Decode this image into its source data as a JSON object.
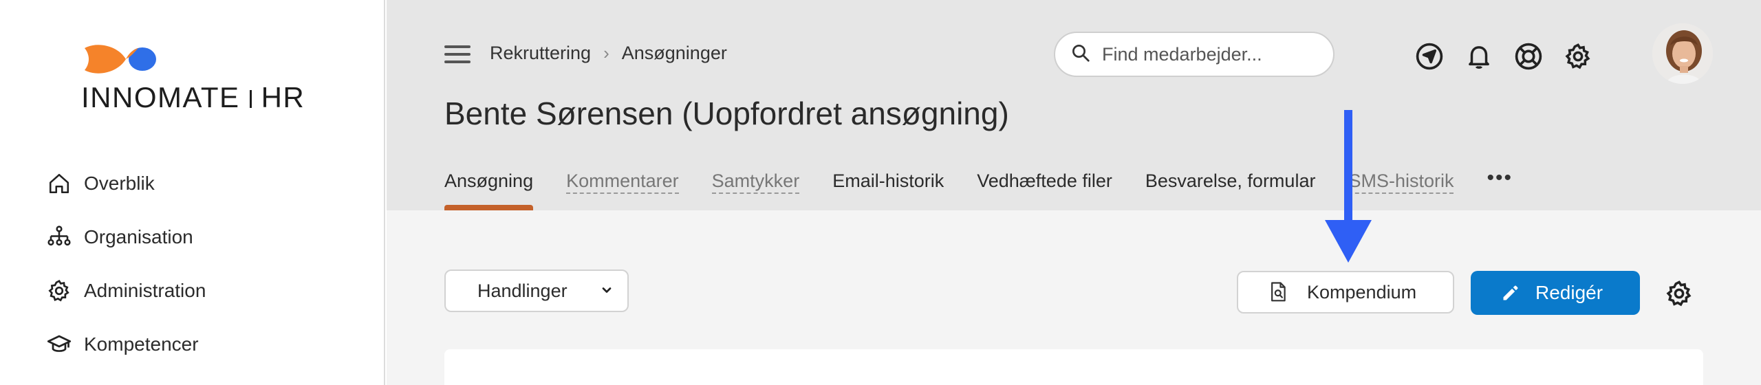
{
  "brand": {
    "name_left": "INNOMATE",
    "name_right": "HR",
    "colors": {
      "orange": "#f5832a",
      "blue": "#2f6fe8",
      "accent": "#c4612a",
      "primary": "#0a7acb"
    }
  },
  "sidebar": {
    "items": [
      {
        "label": "Overblik",
        "icon": "home-icon"
      },
      {
        "label": "Organisation",
        "icon": "org-chart-icon"
      },
      {
        "label": "Administration",
        "icon": "gear-icon"
      },
      {
        "label": "Kompetencer",
        "icon": "graduation-cap-icon"
      }
    ]
  },
  "header": {
    "breadcrumb": [
      "Rekruttering",
      "Ansøgninger"
    ],
    "search_placeholder": "Find medarbejder...",
    "icons": [
      "navigation-icon",
      "bell-icon",
      "lifebuoy-icon",
      "gear-icon"
    ],
    "page_title": "Bente Sørensen (Uopfordret ansøgning)",
    "tabs": [
      {
        "label": "Ansøgning",
        "active": true
      },
      {
        "label": "Kommentarer"
      },
      {
        "label": "Samtykker"
      },
      {
        "label": "Email-historik"
      },
      {
        "label": "Vedhæftede filer"
      },
      {
        "label": "Besvarelse, formular"
      },
      {
        "label": "SMS-historik"
      },
      {
        "label": "•••"
      }
    ]
  },
  "main": {
    "actions_label": "Handlinger",
    "kompendium_label": "Kompendium",
    "edit_label": "Redigér"
  }
}
